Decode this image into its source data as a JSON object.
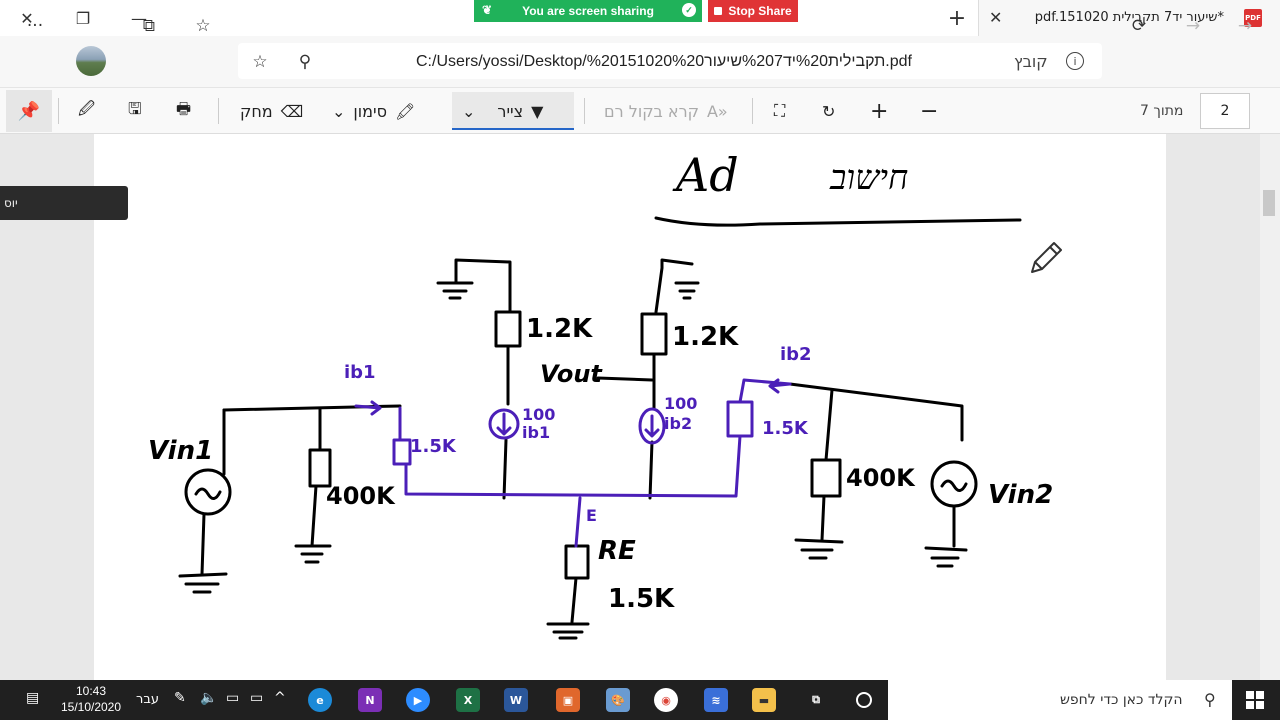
{
  "browser": {
    "tab_title": "*שיעור יד7 תקבילית pdf.151020",
    "tab_icon_label": "PDF",
    "address": "C:/Users/yossi/Desktop/%20151020תקבילית%20יד%207שיעור%20.pdf",
    "file_label": "קובץ",
    "screen_sharing_text": "You are screen sharing",
    "stop_share_label": "Stop Share"
  },
  "pdf_toolbar": {
    "erase_label": "מחק",
    "highlight_label": "סימון",
    "draw_label": "צייר",
    "read_aloud_label": "קרא בקול רם",
    "page_current": "2",
    "page_total": "מתוך 7"
  },
  "tooltip": {
    "text": "יוס"
  },
  "sketch": {
    "title": "Ad",
    "subtitle": "חישוב",
    "labels": {
      "r_left_top": "1.2K",
      "r_right_top": "1.2K",
      "vout": "Vout",
      "src_left": "100 ib1",
      "src_right": "100 ib2",
      "ib1": "ib1",
      "ib2": "ib2",
      "r_left_mid": "1.5K",
      "r_right_mid": "1.5K",
      "r_left_bias": "400K",
      "r_right_bias": "400K",
      "vin1": "Vin1",
      "vin2": "Vin2",
      "node_e": "E",
      "re": "RE",
      "re_val": "1.5K"
    },
    "colors": {
      "ink": "#000000",
      "pen": "#4b1fb8"
    }
  },
  "taskbar": {
    "time": "10:43",
    "date": "15/10/2020",
    "language": "עבר",
    "search_placeholder": "הקלד כאן כדי לחפש"
  }
}
